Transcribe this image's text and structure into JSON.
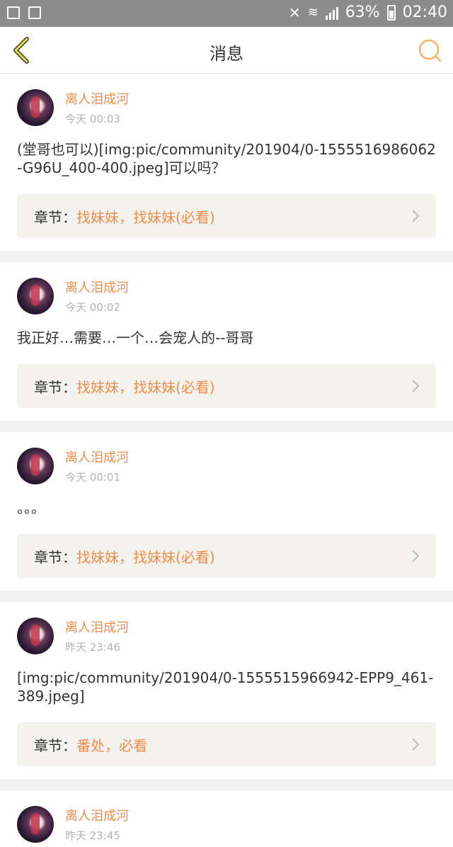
{
  "status": {
    "battery": "63%",
    "time": "02:40",
    "network": "3G"
  },
  "header": {
    "title": "消息"
  },
  "posts": [
    {
      "name": "离人泪成河",
      "time": "今天 00:03",
      "content": "(堂哥也可以)[img:pic/community/201904/0-1555516986062-G96U_400-400.jpeg]可以吗？",
      "chapter_label": "章节：",
      "chapter": "找妹妹，找妹妹(必看)"
    },
    {
      "name": "离人泪成河",
      "time": "今天 00:02",
      "content": "我正好…需要…一个…会宠人的--哥哥",
      "chapter_label": "章节：",
      "chapter": "找妹妹，找妹妹(必看)"
    },
    {
      "name": "离人泪成河",
      "time": "今天 00:01",
      "content": "。。。",
      "chapter_label": "章节：",
      "chapter": "找妹妹，找妹妹(必看)"
    },
    {
      "name": "离人泪成河",
      "time": "昨天 23:46",
      "content": "[img:pic/community/201904/0-1555515966942-EPP9_461-389.jpeg]",
      "chapter_label": "章节：",
      "chapter": "番处，必看"
    },
    {
      "name": "离人泪成河",
      "time": "昨天 23:45"
    }
  ],
  "colors": {
    "accent": "#ef8c4b",
    "chapter_bg": "#f3f2ec"
  },
  "icons": {
    "back": "chevron-left-icon",
    "search": "search-icon",
    "chapter": "chevron-right-icon"
  }
}
